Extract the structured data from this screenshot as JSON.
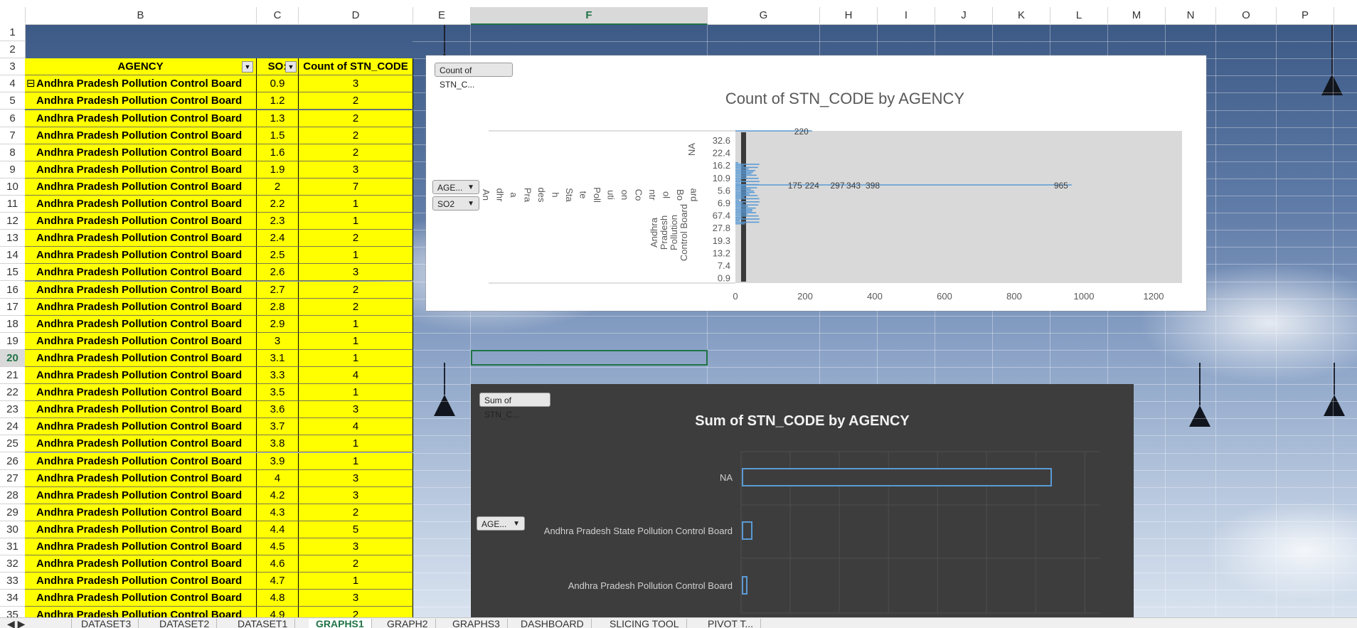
{
  "columns": [
    "B",
    "C",
    "D",
    "E",
    "F",
    "G",
    "H",
    "I",
    "J",
    "K",
    "L",
    "M",
    "N",
    "O",
    "P"
  ],
  "selected_column": "F",
  "selected_row": "20",
  "rows": [
    "1",
    "2",
    "3",
    "4",
    "5",
    "6",
    "7",
    "8",
    "9",
    "10",
    "11",
    "12",
    "13",
    "14",
    "15",
    "16",
    "17",
    "18",
    "19",
    "20",
    "21",
    "22",
    "23",
    "24",
    "25",
    "26",
    "27",
    "28",
    "29",
    "30",
    "31",
    "32",
    "33",
    "34",
    "35"
  ],
  "pivot": {
    "headers": {
      "agency": "AGENCY",
      "so2": "SO:",
      "count": "Count of STN_CODE"
    },
    "collapse_glyph": "⊟",
    "agency_name": "Andhra Pradesh  Pollution Control Board",
    "so2_values": [
      "0.9",
      "1.2",
      "1.3",
      "1.5",
      "1.6",
      "1.9",
      "2",
      "2.2",
      "2.3",
      "2.4",
      "2.5",
      "2.6",
      "2.7",
      "2.8",
      "2.9",
      "3",
      "3.1",
      "3.3",
      "3.5",
      "3.6",
      "3.7",
      "3.8",
      "3.9",
      "4",
      "4.2",
      "4.3",
      "4.4",
      "4.5",
      "4.6",
      "4.7",
      "4.8",
      "4.9"
    ],
    "count_values": [
      "3",
      "2",
      "2",
      "2",
      "2",
      "3",
      "7",
      "1",
      "1",
      "2",
      "1",
      "3",
      "2",
      "2",
      "1",
      "1",
      "1",
      "4",
      "1",
      "3",
      "4",
      "1",
      "1",
      "3",
      "3",
      "2",
      "5",
      "3",
      "2",
      "1",
      "3",
      "2"
    ]
  },
  "chart1": {
    "field_button": "Count of STN_C...",
    "filter_agency": "AGE...",
    "filter_so2": "SO2",
    "chart_data": {
      "type": "bar",
      "orientation": "horizontal",
      "title": "Count of STN_CODE by AGENCY",
      "x_ticks": [
        "0",
        "200",
        "400",
        "600",
        "800",
        "1000",
        "1200"
      ],
      "xlim": [
        0,
        1200
      ],
      "y_tick_labels": [
        "32.6",
        "22.4",
        "16.2",
        "10.9",
        "5.6",
        "6.9",
        "67.4",
        "27.8",
        "19.3",
        "13.2",
        "7.4",
        "0.9"
      ],
      "group_labels": [
        "NA",
        "Andhra Pradesh Pollution Control Board",
        "An dhr a Pra des h Sta te Poll uti on Co ntr ol Bo ard"
      ],
      "data_labels": [
        "220",
        "965",
        "175",
        "224",
        "297",
        "343",
        "398"
      ],
      "values": [
        220,
        965,
        175,
        224,
        297,
        343,
        398
      ],
      "grid": true
    }
  },
  "chart2": {
    "field_button": "Sum of STN_C...",
    "filter_agency": "AGE...",
    "chart_data": {
      "type": "bar",
      "orientation": "horizontal",
      "title": "Sum of STN_CODE by AGENCY",
      "categories": [
        "NA",
        "Andhra Pradesh State Pollution Control Board",
        "Andhra Pradesh  Pollution Control Board"
      ],
      "values": [
        100,
        3,
        1
      ],
      "grid": true,
      "colors": {
        "bar": "#3d3d3d",
        "bar_border": "#5b9bd5",
        "background": "#3d3d3d",
        "text": "#d0d0d0"
      }
    }
  },
  "sheet_tabs": [
    "DATASET3",
    "DATASET2",
    "DATASET1",
    "GRAPHS1",
    "GRAPH2",
    "GRAPHS3",
    "DASHBOARD",
    "SLICING TOOL",
    "PIVOT T..."
  ],
  "active_tab": "GRAPHS1",
  "colors": {
    "accent": "#217346",
    "pivot_fill": "#ffff00"
  }
}
